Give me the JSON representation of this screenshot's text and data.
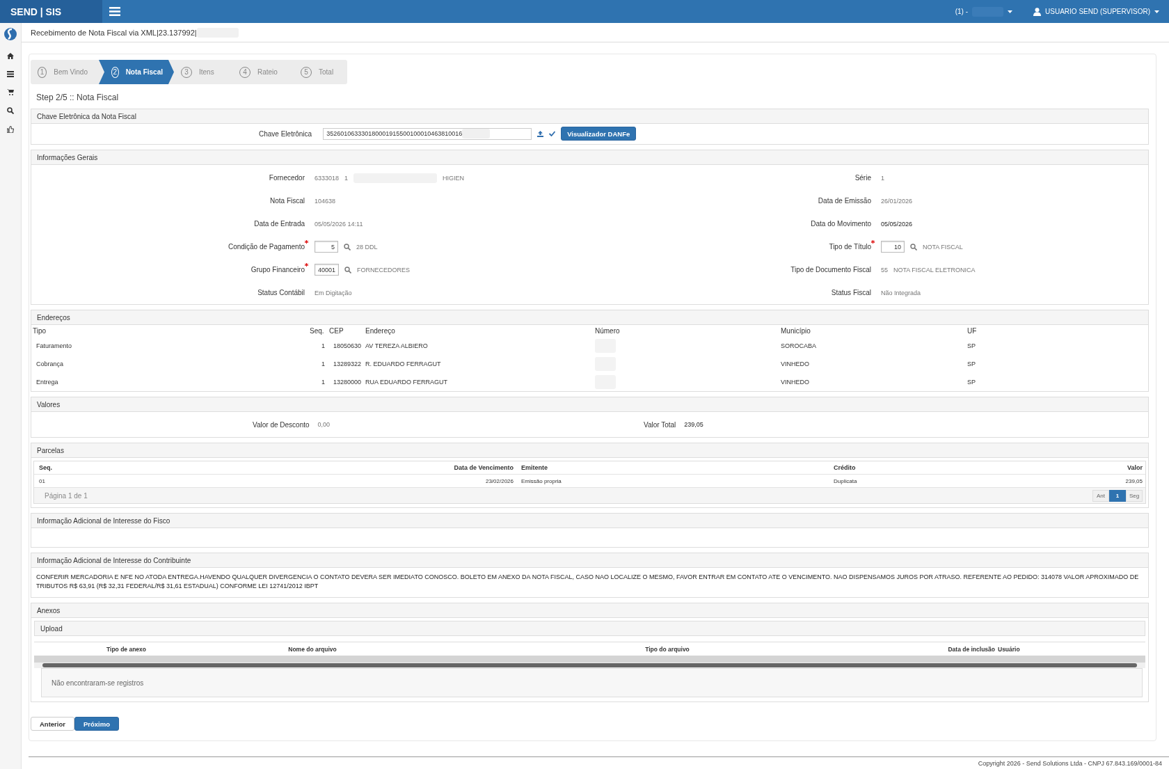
{
  "header": {
    "brand": "SEND | SIS",
    "company": "(1) -",
    "user": "USUARIO SEND (SUPERVISOR)"
  },
  "page_title": "Recebimento de Nota Fiscal via XML|23.137992|",
  "wizard": [
    {
      "number": "1",
      "label": "Bem Vindo",
      "selected": false
    },
    {
      "number": "2",
      "label": "Nota Fiscal",
      "selected": true
    },
    {
      "number": "3",
      "label": "Itens",
      "selected": false
    },
    {
      "number": "4",
      "label": "Rateio",
      "selected": false
    },
    {
      "number": "5",
      "label": "Total",
      "selected": false
    }
  ],
  "step_title": "Step 2/5 :: Nota Fiscal",
  "chave": {
    "title": "Chave Eletrônica da Nota Fiscal",
    "label": "Chave Eletrônica",
    "value": "352601063330180001915500100010463810016",
    "button": "Visualizador DANFe"
  },
  "info": {
    "title": "Informações Gerais",
    "rows": [
      [
        {
          "kind": "text",
          "label": "Fornecedor",
          "values": [
            "6333018",
            "1",
            "HIGIEN"
          ]
        },
        {
          "kind": "text",
          "label": "Série",
          "values": [
            "1"
          ]
        }
      ],
      [
        {
          "kind": "text",
          "label": "Nota Fiscal",
          "values": [
            "104638"
          ]
        },
        {
          "kind": "text",
          "label": "Data de Emissão",
          "values": [
            "26/01/2026"
          ]
        }
      ],
      [
        {
          "kind": "text",
          "label": "Data de Entrada",
          "values": [
            "05/05/2026 14:11"
          ]
        },
        {
          "kind": "strong",
          "label": "Data do Movimento",
          "values": [
            "05/05/2026"
          ]
        }
      ],
      [
        {
          "kind": "input",
          "label": "Condição de Pagamento",
          "required": true,
          "value": "5",
          "description": "28 DDL"
        },
        {
          "kind": "input",
          "label": "Tipo de Título",
          "required": true,
          "value": "10",
          "description": "NOTA FISCAL"
        }
      ],
      [
        {
          "kind": "input",
          "label": "Grupo Financeiro",
          "required": true,
          "value": "40001",
          "description": "FORNECEDORES"
        },
        {
          "kind": "text",
          "label": "Tipo de Documento Fiscal",
          "values": [
            "55",
            "NOTA FISCAL ELETRONICA"
          ]
        }
      ],
      [
        {
          "kind": "text",
          "label": "Status Contábil",
          "values": [
            "Em Digitação"
          ]
        },
        {
          "kind": "text",
          "label": "Status Fiscal",
          "values": [
            "Não Integrada"
          ]
        }
      ]
    ]
  },
  "enderecos": {
    "title": "Endereços",
    "columns": [
      "Tipo",
      "Seq.",
      "CEP",
      "Endereço",
      "Número",
      "Município",
      "UF"
    ],
    "rows": [
      {
        "tipo": "Faturamento",
        "seq": "1",
        "cep": "18050630",
        "endereco": "AV TEREZA ALBIERO",
        "municipio": "SOROCABA",
        "uf": "SP"
      },
      {
        "tipo": "Cobrança",
        "seq": "1",
        "cep": "13289322",
        "endereco": "R. EDUARDO FERRAGUT",
        "municipio": "VINHEDO",
        "uf": "SP"
      },
      {
        "tipo": "Entrega",
        "seq": "1",
        "cep": "13280000",
        "endereco": "RUA EDUARDO FERRAGUT",
        "municipio": "VINHEDO",
        "uf": "SP"
      }
    ]
  },
  "valores": {
    "title": "Valores",
    "items": [
      {
        "label": "Valor de Desconto",
        "value": "0,00",
        "emphasis": false
      },
      {
        "label": "Valor Total",
        "value": "239,05",
        "emphasis": true
      }
    ]
  },
  "parcelas": {
    "title": "Parcelas",
    "columns": [
      "Seq.",
      "Data de Vencimento",
      "Emitente",
      "Crédito",
      "Valor"
    ],
    "rows": [
      [
        "01",
        "23/02/2026",
        "Emissão propria",
        "Duplicata",
        "239,05"
      ]
    ],
    "page_info": "Página 1 de 1",
    "pages": [
      {
        "label": "Ant",
        "selected": false,
        "disabled": true
      },
      {
        "label": "1",
        "selected": true,
        "disabled": false
      },
      {
        "label": "Seg",
        "selected": false,
        "disabled": true
      }
    ]
  },
  "fisco": {
    "title": "Informação Adicional de Interesse do Fisco"
  },
  "contribuinte": {
    "title": "Informação Adicional de Interesse do Contribuinte",
    "text": "CONFERIR MERCADORIA E NFE NO ATODA ENTREGA.HAVENDO QUALQUER DIVERGENCIA O CONTATO DEVERA SER IMEDIATO CONOSCO. BOLETO EM ANEXO DA NOTA FISCAL, CASO NAO LOCALIZE O MESMO, FAVOR ENTRAR EM CONTATO ATE O VENCIMENTO. NAO DISPENSAMOS JUROS POR ATRASO. REFERENTE AO PEDIDO: 314078 VALOR APROXIMADO DE TRIBUTOS R$ 63,91 (R$ 32,31 FEDERAL/R$ 31,61 ESTADUAL) CONFORME LEI 12741/2012 IBPT"
  },
  "anexos": {
    "title": "Anexos",
    "upload": "Upload",
    "columns": [
      "Tipo de anexo",
      "Nome do arquivo",
      "Tipo do arquivo",
      "Data de inclusão",
      "Usuário"
    ],
    "empty": "Não encontraram-se registros"
  },
  "buttons": [
    {
      "label": "Anterior",
      "primary": false
    },
    {
      "label": "Próximo",
      "primary": true
    }
  ],
  "footer": "Copyright 2026 - Send Solutions Ltda - CNPJ 67.843.169/0001-84"
}
